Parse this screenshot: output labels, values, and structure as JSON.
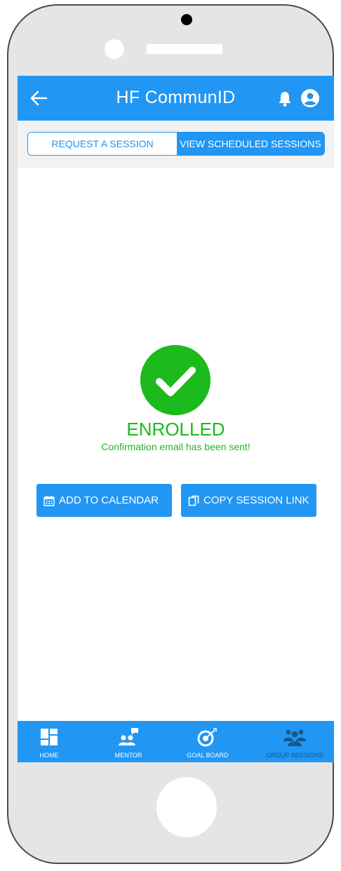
{
  "app": {
    "title": "HF CommunID"
  },
  "tabs": [
    {
      "label": "REQUEST A SESSION",
      "active": false
    },
    {
      "label": "VIEW SCHEDULED SESSIONS",
      "active": true
    }
  ],
  "status": {
    "title": "ENROLLED",
    "message": "Confirmation email has been sent!"
  },
  "actions": {
    "add_to_calendar": "ADD TO CALENDAR",
    "copy_session_link": "COPY SESSION LINK"
  },
  "bottom_nav": [
    {
      "label": "HOME",
      "icon": "dashboard-icon"
    },
    {
      "label": "MENTOR",
      "icon": "mentor-chat-icon"
    },
    {
      "label": "GOAL BOARD",
      "icon": "target-icon"
    },
    {
      "label": "GROUP SESSIONS",
      "icon": "group-icon",
      "active": true
    }
  ],
  "colors": {
    "primary": "#2196f3",
    "success": "#1cba1c",
    "nav_active_label": "#15588a",
    "frame": "#e5e5e5"
  }
}
